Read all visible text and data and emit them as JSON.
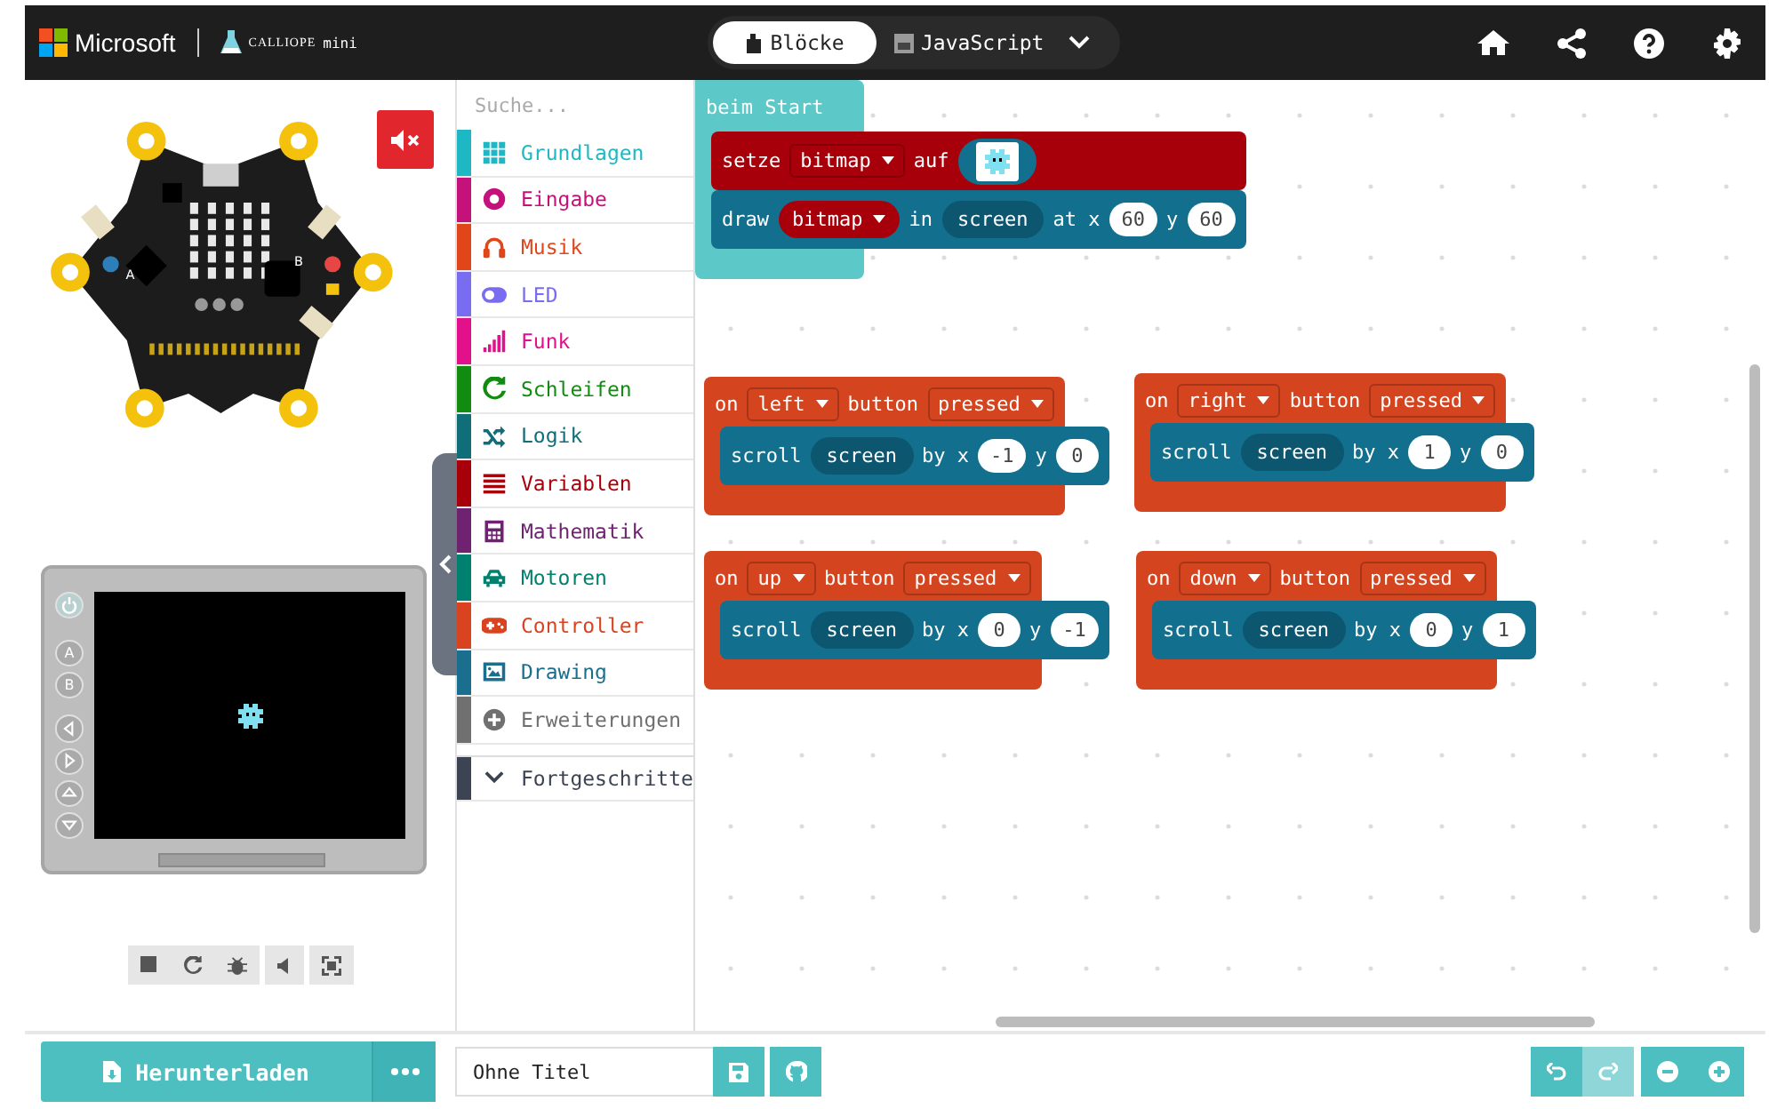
{
  "header": {
    "brand": "Microsoft",
    "product": "CALLIOPE",
    "product_suffix": "mini",
    "tabs": [
      {
        "label": "Blöcke",
        "selected": true
      },
      {
        "label": "JavaScript",
        "selected": false
      }
    ]
  },
  "simulator": {
    "muted": true,
    "board_buttons": [
      "A",
      "B"
    ],
    "gamepad_buttons": [
      {
        "kind": "power"
      },
      {
        "kind": "letter",
        "text": "A"
      },
      {
        "kind": "letter",
        "text": "B"
      },
      {
        "kind": "left"
      },
      {
        "kind": "right"
      },
      {
        "kind": "up"
      },
      {
        "kind": "down"
      }
    ]
  },
  "toolbox": {
    "search": {
      "placeholder": "Suche..."
    },
    "categories": [
      {
        "name": "Grundlagen",
        "color": "#1eb8c4",
        "kind": "category"
      },
      {
        "name": "Eingabe",
        "color": "#c4127a",
        "kind": "category"
      },
      {
        "name": "Musik",
        "color": "#e0461a",
        "kind": "category"
      },
      {
        "name": "LED",
        "color": "#7a6cf0",
        "kind": "category"
      },
      {
        "name": "Funk",
        "color": "#e3108c",
        "kind": "category"
      },
      {
        "name": "Schleifen",
        "color": "#118c11",
        "kind": "category"
      },
      {
        "name": "Logik",
        "color": "#106e78",
        "kind": "category"
      },
      {
        "name": "Variablen",
        "color": "#a8000a",
        "kind": "category"
      },
      {
        "name": "Mathematik",
        "color": "#6e2270",
        "kind": "category"
      },
      {
        "name": "Motoren",
        "color": "#00806e",
        "kind": "category"
      },
      {
        "name": "Controller",
        "color": "#d9431f",
        "kind": "category"
      },
      {
        "name": "Drawing",
        "color": "#1a6e8e",
        "kind": "category"
      },
      {
        "name": "Erweiterungen",
        "color": "#707070",
        "kind": "category"
      },
      {
        "name": "Fortgeschritte",
        "color": "#3c4454",
        "kind": "toggle",
        "expanded": false
      }
    ]
  },
  "workspace": {
    "blocks": [
      {
        "kind": "start",
        "title": [
          {
            "kind": "text",
            "text": "beim Start"
          }
        ],
        "body": [
          {
            "kind": "variables",
            "parts": [
              {
                "kind": "text",
                "text": "setze"
              },
              {
                "kind": "dropdown",
                "text": "bitmap"
              },
              {
                "kind": "text",
                "text": "auf"
              },
              {
                "kind": "image"
              }
            ]
          },
          {
            "kind": "drawing",
            "parts": [
              {
                "kind": "text",
                "text": "draw"
              },
              {
                "kind": "var_dropdown",
                "text": "bitmap"
              },
              {
                "kind": "text",
                "text": "in"
              },
              {
                "kind": "pill",
                "text": "screen"
              },
              {
                "kind": "text",
                "text": "at x"
              },
              {
                "kind": "number",
                "text": "60"
              },
              {
                "kind": "text",
                "text": "y"
              },
              {
                "kind": "number",
                "text": "60"
              }
            ]
          }
        ]
      },
      {
        "kind": "controller",
        "title": [
          {
            "kind": "text",
            "text": "on"
          },
          {
            "kind": "dropdown",
            "text": "left"
          },
          {
            "kind": "text",
            "text": "button"
          },
          {
            "kind": "dropdown",
            "text": "pressed"
          }
        ],
        "body": [
          {
            "kind": "drawing",
            "parts": [
              {
                "kind": "text",
                "text": "scroll"
              },
              {
                "kind": "pill",
                "text": "screen"
              },
              {
                "kind": "text",
                "text": "by x"
              },
              {
                "kind": "number",
                "text": "-1"
              },
              {
                "kind": "text",
                "text": "y"
              },
              {
                "kind": "number",
                "text": "0"
              }
            ]
          }
        ]
      },
      {
        "kind": "controller",
        "title": [
          {
            "kind": "text",
            "text": "on"
          },
          {
            "kind": "dropdown",
            "text": "right"
          },
          {
            "kind": "text",
            "text": "button"
          },
          {
            "kind": "dropdown",
            "text": "pressed"
          }
        ],
        "body": [
          {
            "kind": "drawing",
            "parts": [
              {
                "kind": "text",
                "text": "scroll"
              },
              {
                "kind": "pill",
                "text": "screen"
              },
              {
                "kind": "text",
                "text": "by x"
              },
              {
                "kind": "number",
                "text": "1"
              },
              {
                "kind": "text",
                "text": "y"
              },
              {
                "kind": "number",
                "text": "0"
              }
            ]
          }
        ]
      },
      {
        "kind": "controller",
        "title": [
          {
            "kind": "text",
            "text": "on"
          },
          {
            "kind": "dropdown",
            "text": "up"
          },
          {
            "kind": "text",
            "text": "button"
          },
          {
            "kind": "dropdown",
            "text": "pressed"
          }
        ],
        "body": [
          {
            "kind": "drawing",
            "parts": [
              {
                "kind": "text",
                "text": "scroll"
              },
              {
                "kind": "pill",
                "text": "screen"
              },
              {
                "kind": "text",
                "text": "by x"
              },
              {
                "kind": "number",
                "text": "0"
              },
              {
                "kind": "text",
                "text": "y"
              },
              {
                "kind": "number",
                "text": "-1"
              }
            ]
          }
        ]
      },
      {
        "kind": "controller",
        "title": [
          {
            "kind": "text",
            "text": "on"
          },
          {
            "kind": "dropdown",
            "text": "down"
          },
          {
            "kind": "text",
            "text": "button"
          },
          {
            "kind": "dropdown",
            "text": "pressed"
          }
        ],
        "body": [
          {
            "kind": "drawing",
            "parts": [
              {
                "kind": "text",
                "text": "scroll"
              },
              {
                "kind": "pill",
                "text": "screen"
              },
              {
                "kind": "text",
                "text": "by x"
              },
              {
                "kind": "number",
                "text": "0"
              },
              {
                "kind": "text",
                "text": "y"
              },
              {
                "kind": "number",
                "text": "1"
              }
            ]
          }
        ]
      }
    ]
  },
  "footer": {
    "download": "Herunterladen",
    "project_name": "Ohne Titel",
    "undo_enabled": true,
    "redo_enabled": false
  }
}
